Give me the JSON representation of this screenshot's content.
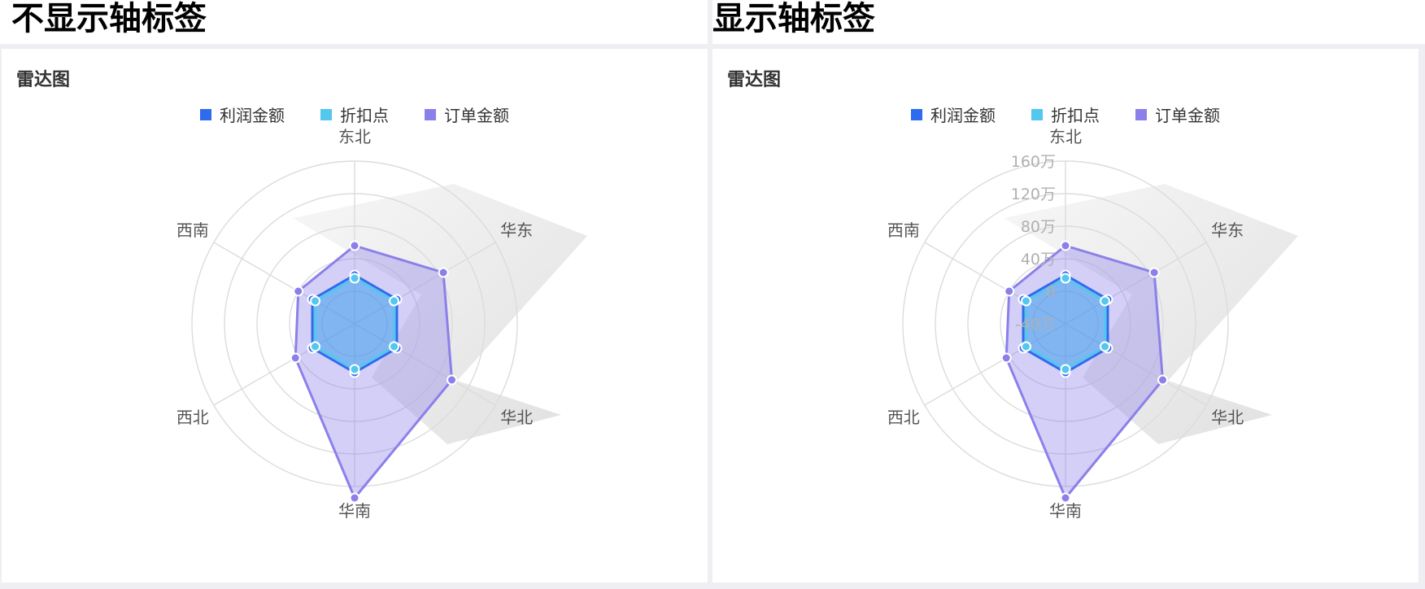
{
  "headings": {
    "left": "不显示轴标签",
    "right": "显示轴标签"
  },
  "panel_title": "雷达图",
  "colors": {
    "profit": "#2f6bee",
    "discount": "#54c7ef",
    "orders": "#8b80ea"
  },
  "chart_data": [
    {
      "type": "radar",
      "title": "雷达图",
      "show_axis_labels": false,
      "categories": [
        "东北",
        "华东",
        "华北",
        "华南",
        "西北",
        "西南"
      ],
      "series": [
        {
          "name": "利润金额",
          "values": [
            20,
            20,
            20,
            20,
            20,
            20
          ]
        },
        {
          "name": "折扣点",
          "values": [
            16,
            16,
            16,
            16,
            16,
            16
          ]
        },
        {
          "name": "订单金额",
          "values": [
            56,
            86,
            98,
            174,
            44,
            40
          ]
        }
      ],
      "rlim": [
        -40,
        160
      ],
      "tick_values": [
        -40,
        0,
        40,
        80,
        120,
        160
      ],
      "tick_labels": [],
      "legend_position": "top",
      "grid": true
    },
    {
      "type": "radar",
      "title": "雷达图",
      "show_axis_labels": true,
      "categories": [
        "东北",
        "华东",
        "华北",
        "华南",
        "西北",
        "西南"
      ],
      "series": [
        {
          "name": "利润金额",
          "values": [
            20,
            20,
            20,
            20,
            20,
            20
          ]
        },
        {
          "name": "折扣点",
          "values": [
            16,
            16,
            16,
            16,
            16,
            16
          ]
        },
        {
          "name": "订单金额",
          "values": [
            56,
            86,
            98,
            174,
            44,
            40
          ]
        }
      ],
      "rlim": [
        -40,
        160
      ],
      "tick_values": [
        -40,
        0,
        40,
        80,
        120,
        160
      ],
      "tick_labels": [
        "-40万",
        "0",
        "40万",
        "80万",
        "120万",
        "160万"
      ],
      "legend_position": "top",
      "grid": true
    }
  ]
}
